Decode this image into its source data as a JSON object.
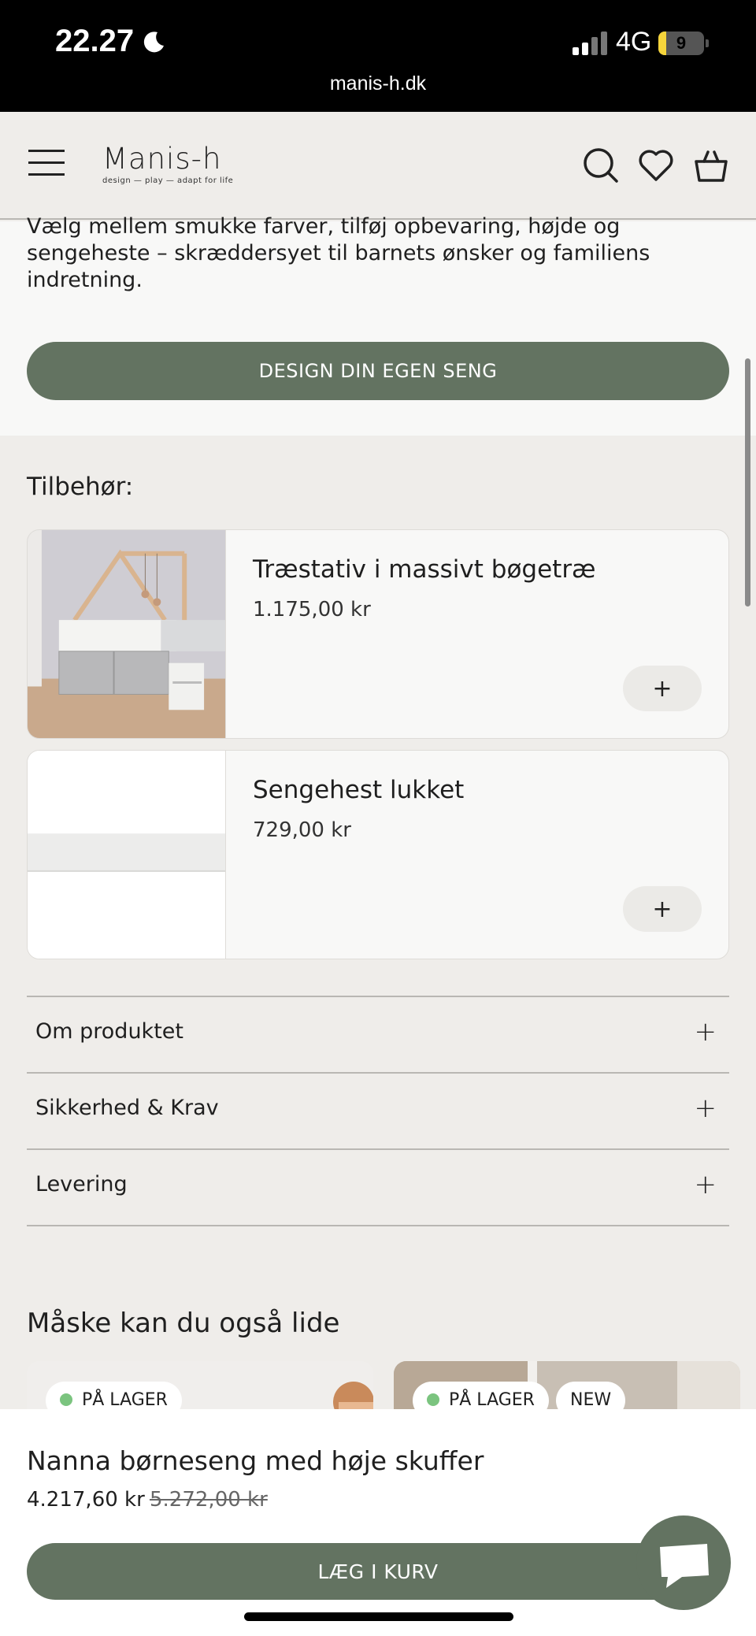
{
  "status_bar": {
    "time": "22.27",
    "network": "4G",
    "battery_level": "9",
    "battery_fraction": 0.09,
    "url": "manis-h.dk"
  },
  "header": {
    "logo_text": "Manis-h",
    "logo_tagline": "design — play — adapt for life",
    "icons": [
      "menu-icon",
      "search-icon",
      "heart-icon",
      "bag-icon"
    ]
  },
  "intro": {
    "text": "Vælg mellem smukke farver, tilføj opbevaring, højde og sengeheste – skræddersyet til barnets ønsker og familiens indretning.",
    "design_button": "DESIGN DIN EGEN SENG"
  },
  "accessories": {
    "title": "Tilbehør:",
    "items": [
      {
        "name": "Træstativ i massivt bøgetræ",
        "price": "1.175,00 kr",
        "add_label": "+"
      },
      {
        "name": "Sengehest lukket",
        "price": "729,00 kr",
        "add_label": "+"
      }
    ]
  },
  "accordion": [
    {
      "label": "Om produktet",
      "icon": "+"
    },
    {
      "label": "Sikkerhed & Krav",
      "icon": "+"
    },
    {
      "label": "Levering",
      "icon": "+"
    }
  ],
  "recommendations": {
    "title": "Måske kan du også lide",
    "cards": [
      {
        "badges": [
          "PÅ LAGER"
        ]
      },
      {
        "badges": [
          "PÅ LAGER",
          "NEW"
        ]
      }
    ]
  },
  "sticky_bar": {
    "product": "Nanna børneseng med høje skuffer",
    "price": "4.217,60 kr",
    "old_price": "5.272,00 kr",
    "cart_button": "LÆG I KURV"
  },
  "colors": {
    "accent": "#637361",
    "background": "#efedea",
    "in_stock_dot": "#7bc47f"
  }
}
